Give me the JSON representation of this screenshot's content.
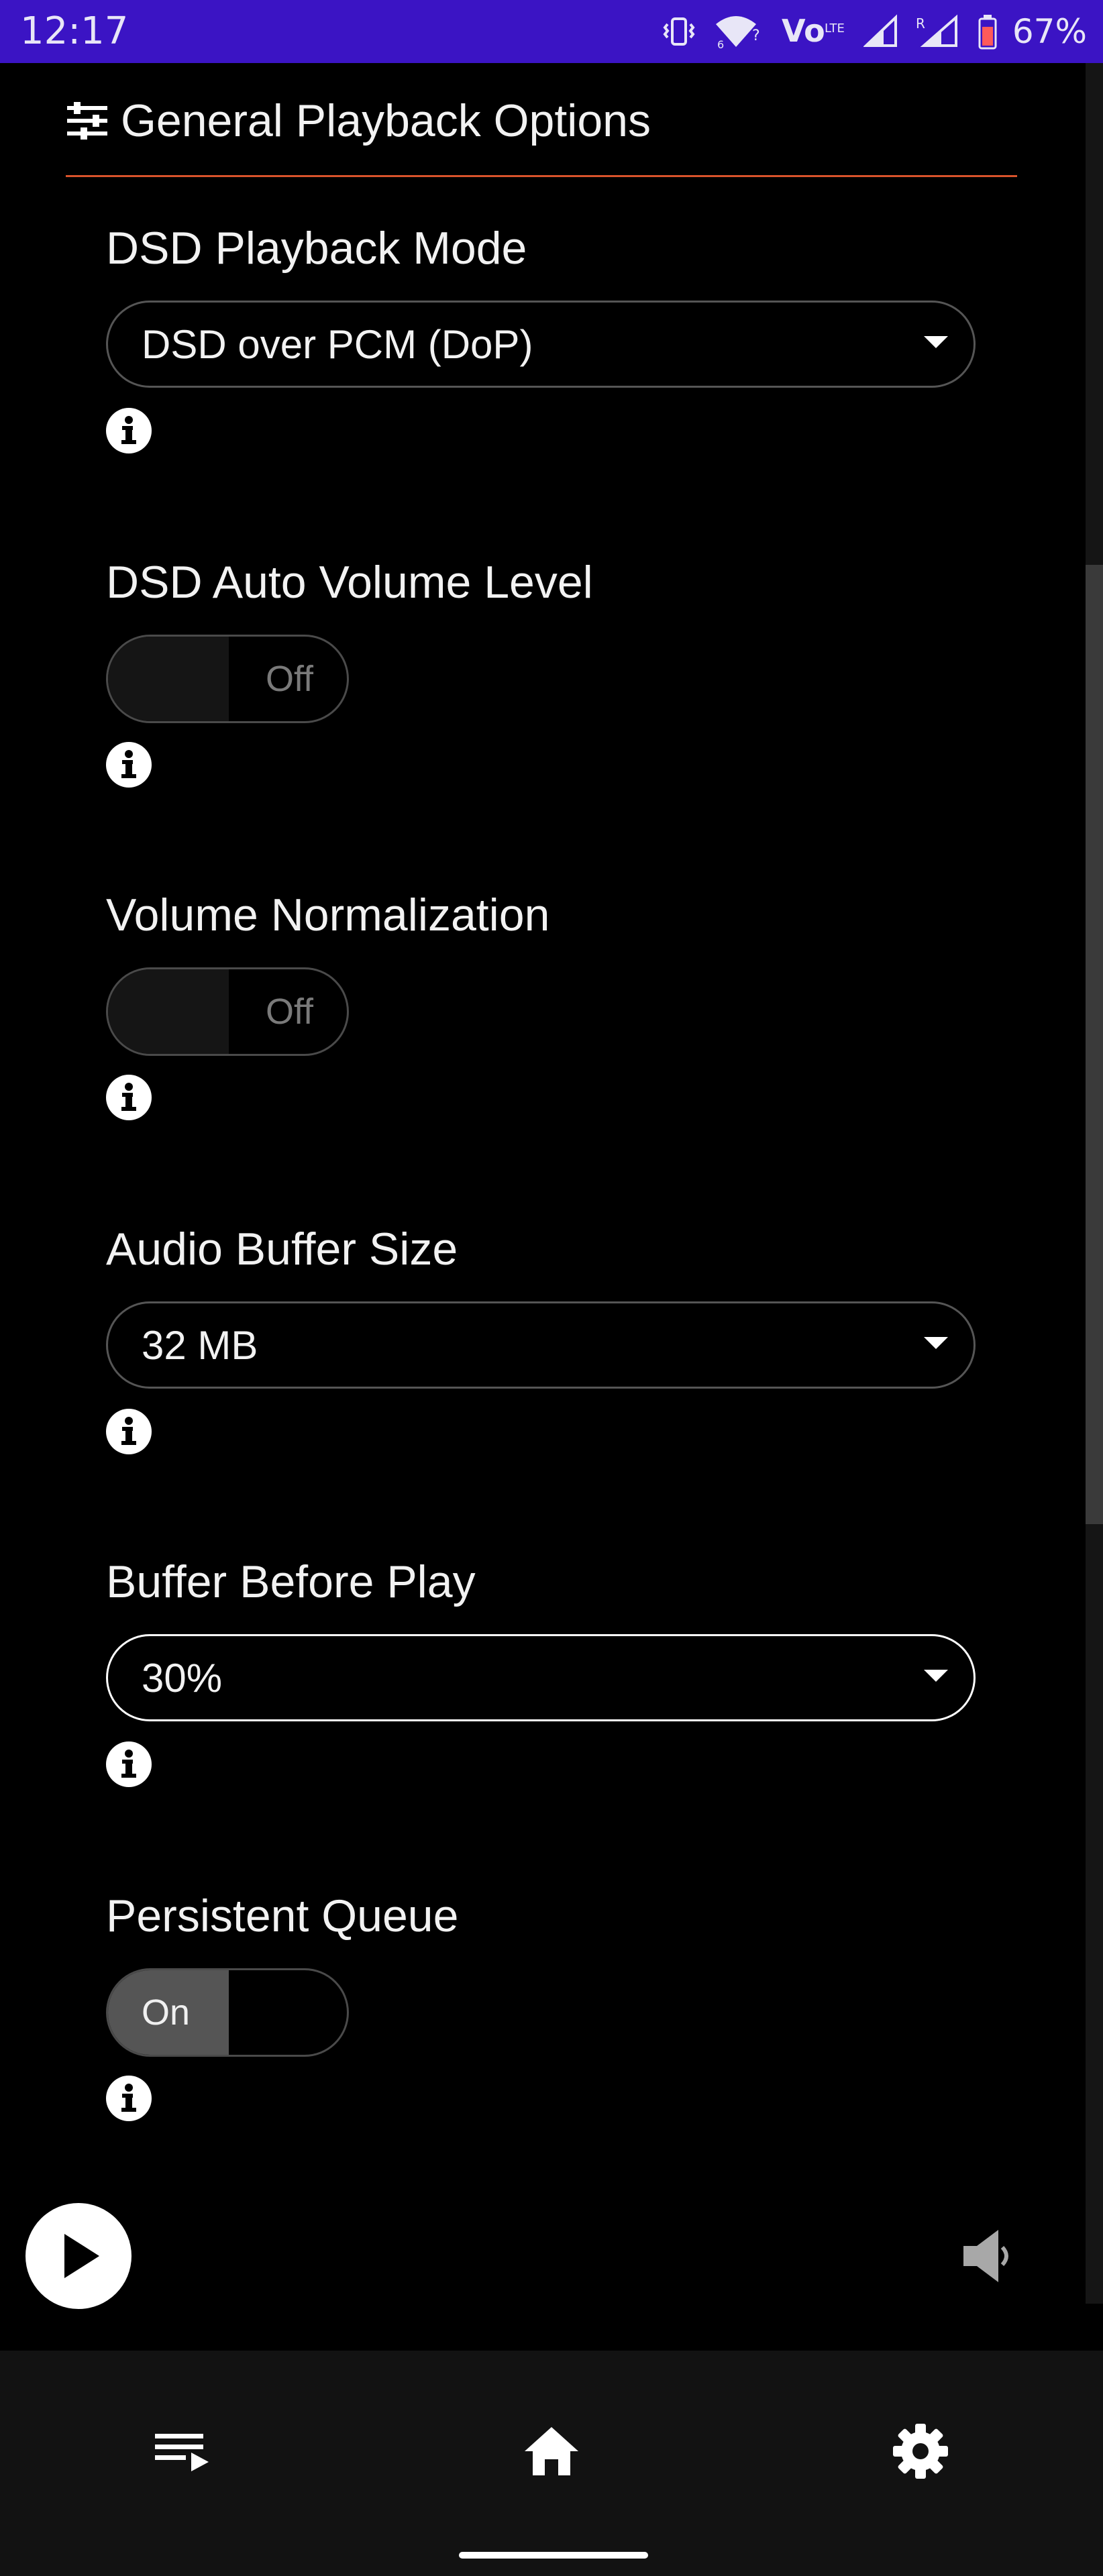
{
  "status_bar": {
    "time": "12:17",
    "battery_percent": "67%",
    "icons": [
      "vibrate-icon",
      "wifi-icon",
      "volte-icon",
      "signal-icon",
      "roaming-signal-icon",
      "battery-icon"
    ]
  },
  "section": {
    "icon": "sliders-icon",
    "title": "General Playback Options",
    "divider_color": "#d9532b"
  },
  "settings": [
    {
      "label": "DSD Playback Mode",
      "type": "select",
      "value": "DSD over PCM (DoP)"
    },
    {
      "label": "DSD Auto Volume Level",
      "type": "toggle",
      "value": "Off"
    },
    {
      "label": "Volume Normalization",
      "type": "toggle",
      "value": "Off"
    },
    {
      "label": "Audio Buffer Size",
      "type": "select",
      "value": "32 MB"
    },
    {
      "label": "Buffer Before Play",
      "type": "select",
      "value": "30%"
    },
    {
      "label": "Persistent Queue",
      "type": "toggle",
      "value": "On"
    }
  ],
  "player": {
    "play_icon": "play-icon",
    "volume_icon": "volume-icon"
  },
  "bottom_nav": {
    "items": [
      "queue-icon",
      "home-icon",
      "settings-gear-icon"
    ]
  },
  "colors": {
    "status_bar": "#3b14c4",
    "background": "#000000",
    "nav_background": "#121212"
  }
}
